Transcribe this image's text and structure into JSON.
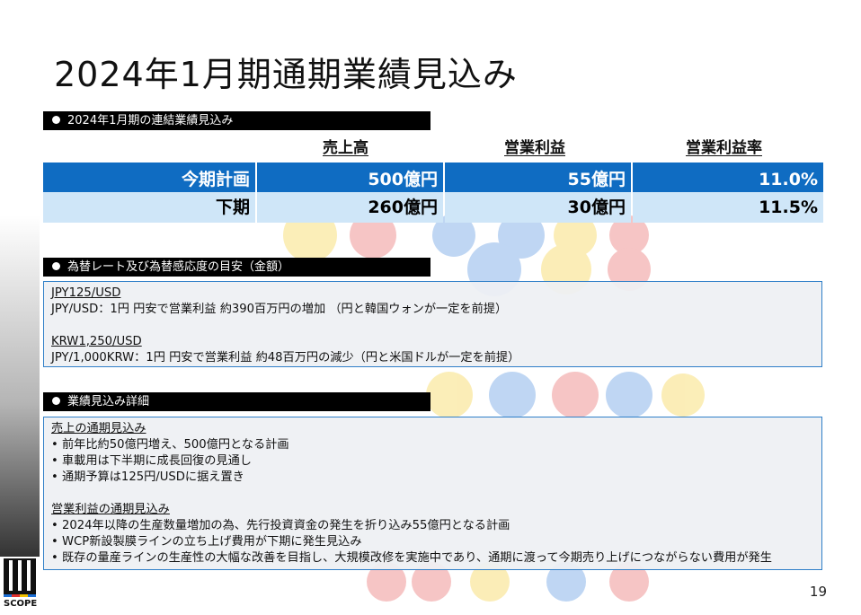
{
  "title": "2024年1月期通期業績見込み",
  "section1": {
    "heading": "2024年1月期の連結業績見込み",
    "columns": [
      "売上高",
      "営業利益",
      "営業利益率"
    ],
    "rows": [
      {
        "label": "今期計画",
        "sales": "500億円",
        "op_profit": "55億円",
        "op_margin": "11.0%"
      },
      {
        "label": "下期",
        "sales": "260億円",
        "op_profit": "30億円",
        "op_margin": "11.5%"
      }
    ]
  },
  "section2": {
    "heading": "為替レート及び為替感応度の目安（金額）",
    "block1_title": "JPY125/USD",
    "block1_text": "JPY/USD：1円 円安で営業利益 約390百万円の増加 （円と韓国ウォンが一定を前提）",
    "block2_title": "KRW1,250/USD",
    "block2_text": "JPY/1,000KRW：1円 円安で営業利益 約48百万円の減少（円と米国ドルが一定を前提）"
  },
  "section3": {
    "heading": "業績見込み詳細",
    "sales_title": "売上の通期見込み",
    "sales_items": [
      "前年比約50億円増え、500億円となる計画",
      "車載用は下半期に成長回復の見通し",
      "通期予算は125円/USDに据え置き"
    ],
    "profit_title": "営業利益の通期見込み",
    "profit_items": [
      "2024年以降の生産数量増加の為、先行投資資金の発生を折り込み55億円となる計画",
      "WCP新設製膜ラインの立ち上げ費用が下期に発生見込み",
      "既存の量産ラインの生産性の大幅な改善を目指し、大規模改修を実施中であり、通期に渡って今期売り上げにつながらない費用が発生"
    ]
  },
  "page_number": "19",
  "logo_text": "SCOPE",
  "colors": {
    "accent_blue": "#0f6cc2",
    "light_blue": "#cfe6f8",
    "box_border": "#2f7fc8"
  }
}
